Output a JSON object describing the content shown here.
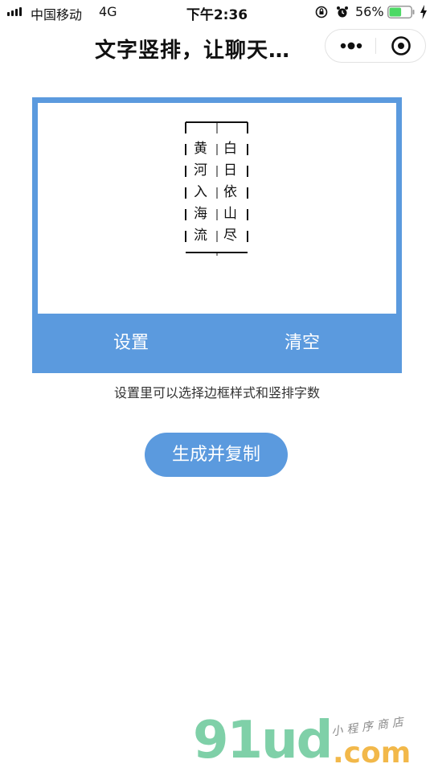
{
  "status_bar": {
    "carrier": "中国移动",
    "network": "4G",
    "time": "下午2:36",
    "battery_percent": "56%",
    "battery_level": 0.56,
    "icons": [
      "signal-icon",
      "orientation-lock-icon",
      "alarm-icon",
      "battery-icon",
      "charging-icon"
    ]
  },
  "nav": {
    "title": "文字竖排，让聊天…",
    "menu_icon": "more-dots-icon",
    "close_icon": "close-circle-icon"
  },
  "preview": {
    "columns": [
      [
        "黄",
        "河",
        "入",
        "海",
        "流"
      ],
      [
        "白",
        "日",
        "依",
        "山",
        "尽"
      ]
    ]
  },
  "actions": {
    "settings_label": "设置",
    "clear_label": "清空"
  },
  "hint": "设置里可以选择边框样式和竖排字数",
  "generate_label": "生成并复制",
  "watermark": {
    "logo": "91ud",
    "domain": ".com",
    "tagline": "小程序商店"
  },
  "colors": {
    "accent": "#5b9ade",
    "watermark_green": "#7fd0a8",
    "watermark_orange": "#f2b84a"
  }
}
